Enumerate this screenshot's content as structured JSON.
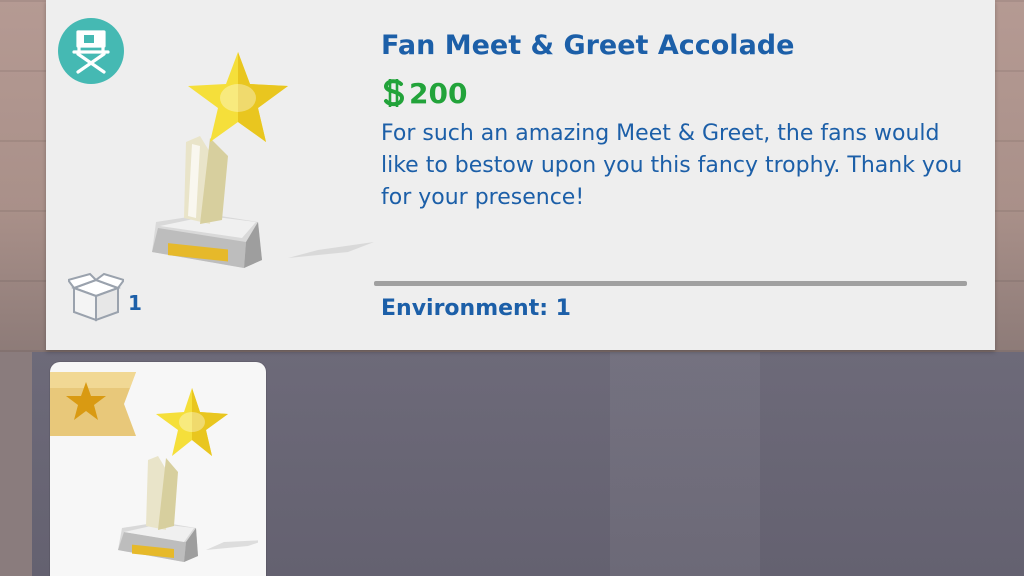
{
  "item": {
    "title": "Fan Meet & Greet Accolade",
    "price": "200",
    "description": "For such an amazing Meet & Greet, the fans would like to bestow upon you this fancy trophy. Thank you for your presence!",
    "environment": "Environment: 1",
    "inventory_count": "1"
  },
  "icons": {
    "category": "director-chair-icon",
    "currency": "simoleon-icon",
    "inventory": "open-box-icon",
    "thumbnail_badge": "star-ribbon-icon"
  },
  "colors": {
    "title": "#1c5fa8",
    "price": "#22a33a",
    "category_badge": "#45b9b3",
    "panel": "#eeeeee"
  }
}
